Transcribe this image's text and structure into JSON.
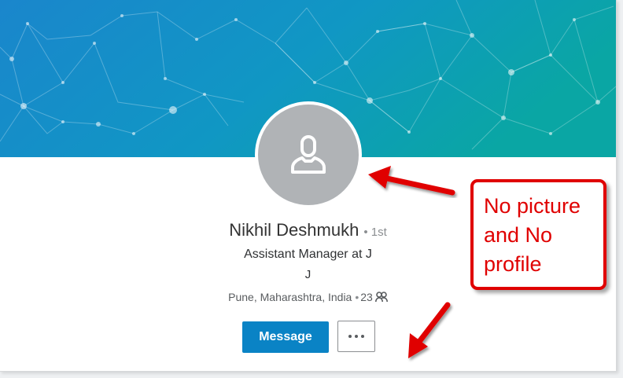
{
  "profile": {
    "name": "Nikhil Deshmukh",
    "degree": "• 1st",
    "headline": "Assistant Manager at J",
    "headline_line2": "J",
    "location": "Pune, Maharashtra, India",
    "connections_prefix": "•",
    "connections": "23",
    "connections_icon": "people-icon",
    "avatar_icon": "person-placeholder-icon"
  },
  "actions": {
    "message_label": "Message",
    "more_icon": "ellipsis-icon"
  },
  "annotation": {
    "text": "No picture\nand No\nprofile",
    "color": "#e00000"
  },
  "colors": {
    "banner_start": "#1b8fd1",
    "banner_end": "#0ea5a8",
    "primary_button": "#0a83c5",
    "avatar_bg": "#b0b3b6"
  }
}
